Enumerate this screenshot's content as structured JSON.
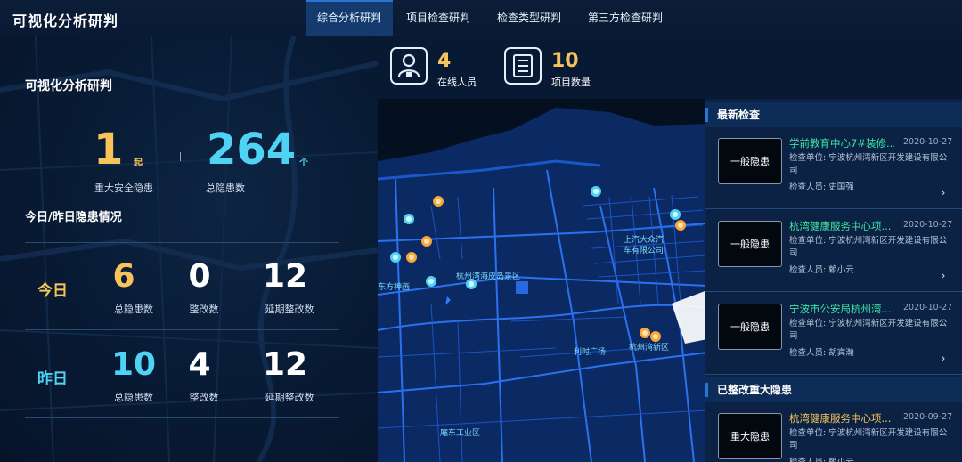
{
  "app": {
    "title": "可视化分析研判"
  },
  "tabs": [
    {
      "label": "综合分析研判"
    },
    {
      "label": "项目检查研判"
    },
    {
      "label": "检查类型研判"
    },
    {
      "label": "第三方检查研判"
    }
  ],
  "left": {
    "title": "可视化分析研判",
    "major": {
      "value": "1",
      "unit": "起",
      "label": "重大安全隐患"
    },
    "total": {
      "value": "264",
      "unit": "个",
      "label": "总隐患数"
    },
    "section_title": "今日/昨日隐患情况",
    "today": {
      "label": "今日",
      "stats": [
        {
          "value": "6",
          "label": "总隐患数"
        },
        {
          "value": "0",
          "label": "整改数"
        },
        {
          "value": "12",
          "label": "延期整改数"
        }
      ]
    },
    "yesterday": {
      "label": "昨日",
      "stats": [
        {
          "value": "10",
          "label": "总隐患数"
        },
        {
          "value": "4",
          "label": "整改数"
        },
        {
          "value": "12",
          "label": "延期整改数"
        }
      ]
    }
  },
  "kpis": [
    {
      "icon": "person-icon",
      "value": "4",
      "label": "在线人员"
    },
    {
      "icon": "list-icon",
      "value": "10",
      "label": "项目数量"
    }
  ],
  "map": {
    "labels": [
      "上汽大众汽",
      "车有限公司",
      "杭州湾海皮岛景区",
      "东方神画",
      "利时广场",
      "杭州湾新区",
      "庵东工业区"
    ]
  },
  "right": {
    "latest_title": "最新检查",
    "rectified_title": "已整改重大隐患",
    "latest": [
      {
        "thumb": "一般隐患",
        "title": "学前教育中心7#装修...",
        "date": "2020-10-27",
        "unit": "检查单位: 宁波杭州湾新区开发建设有限公司",
        "person": "检查人员: 史国强"
      },
      {
        "thumb": "一般隐患",
        "title": "杭湾健康服务中心项...",
        "date": "2020-10-27",
        "unit": "检查单位: 宁波杭州湾新区开发建设有限公司",
        "person": "检查人员: 赖小云"
      },
      {
        "thumb": "一般隐患",
        "title": "宁波市公安局杭州湾...",
        "date": "2020-10-27",
        "unit": "检查单位: 宁波杭州湾新区开发建设有限公司",
        "person": "检查人员: 胡宾瀚"
      }
    ],
    "rectified": [
      {
        "thumb": "重大隐患",
        "title": "杭湾健康服务中心项...",
        "date": "2020-09-27",
        "unit": "检查单位: 宁波杭州湾新区开发建设有限公司",
        "person": "检查人员: 赖小云"
      }
    ]
  },
  "colors": {
    "accent_yellow": "#f7c35b",
    "accent_cyan": "#4fd3f5",
    "title_green": "#3ee6a6",
    "title_orange": "#f7c35b",
    "tab_active": "#153a6e"
  }
}
